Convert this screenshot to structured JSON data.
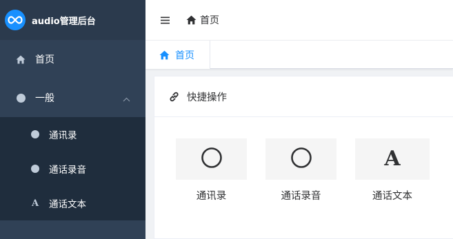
{
  "app": {
    "title": "audio管理后台"
  },
  "sidebar": {
    "items": [
      {
        "label": "首页",
        "icon": "home-icon"
      },
      {
        "label": "一般",
        "icon": "circle-icon",
        "expanded": true,
        "children": [
          {
            "label": "通讯录",
            "icon": "circle-icon"
          },
          {
            "label": "通话录音",
            "icon": "circle-icon"
          },
          {
            "label": "通话文本",
            "icon": "letter-a-icon"
          }
        ]
      }
    ]
  },
  "navbar": {
    "breadcrumb": [
      {
        "label": "首页",
        "icon": "home-icon"
      }
    ]
  },
  "tags": [
    {
      "label": "首页",
      "icon": "home-icon",
      "active": true
    }
  ],
  "card": {
    "title": "快捷操作",
    "icon": "link-icon",
    "shortcuts": [
      {
        "label": "通讯录",
        "icon": "circle-outline-icon"
      },
      {
        "label": "通话录音",
        "icon": "circle-outline-icon"
      },
      {
        "label": "通话文本",
        "icon": "letter-a-icon"
      }
    ]
  },
  "colors": {
    "sidebar_bg": "#304156",
    "submenu_bg": "#1f2d3d",
    "accent": "#1890ff",
    "text": "#303133",
    "icon_muted": "#bfcbd9"
  }
}
